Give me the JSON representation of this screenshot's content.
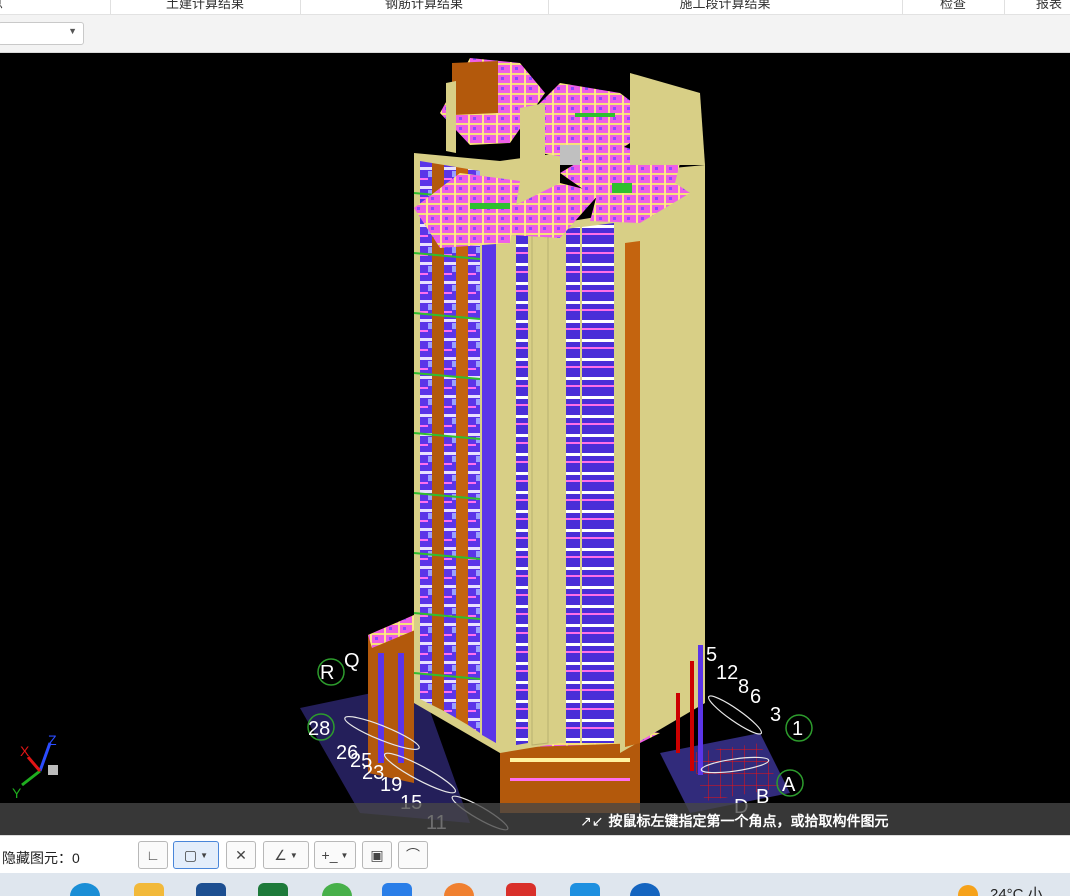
{
  "ribbon_tabs": [
    {
      "label": "息"
    },
    {
      "label": "土建计算结果"
    },
    {
      "label": "钢筋计算结果"
    },
    {
      "label": "施工段计算结果"
    },
    {
      "label": "检查"
    },
    {
      "label": "报表"
    }
  ],
  "combo": {
    "value": ""
  },
  "viewport": {
    "background": "#000000",
    "axis_labels": {
      "top": [
        "R",
        "Q"
      ],
      "left": [
        "28",
        "26",
        "25",
        "23",
        "19",
        "15",
        "11"
      ],
      "right": [
        "5",
        "12",
        "8",
        "6",
        "3",
        "1",
        "A",
        "B",
        "D"
      ]
    },
    "gizmo": {
      "x": "X",
      "y": "Y",
      "z": "Z"
    }
  },
  "status_hint": {
    "icon": "crosshair-arrows-icon",
    "text": "按鼠标左键指定第一个角点，或拾取构件图元"
  },
  "bottom": {
    "hidden_label": "隐藏图元：0",
    "tools": [
      "ortho-icon",
      "select-box-icon",
      "cross-icon",
      "angle-icon",
      "dimension-icon",
      "view-icon",
      "arc-icon"
    ]
  },
  "taskbar": {
    "weather": "24°C 小"
  },
  "colors": {
    "accent": "#4a86d9",
    "building_wall": "#d8cf86",
    "slab": "#e85ee0",
    "frame": "#b35a0c",
    "window": "#5a3df0"
  }
}
